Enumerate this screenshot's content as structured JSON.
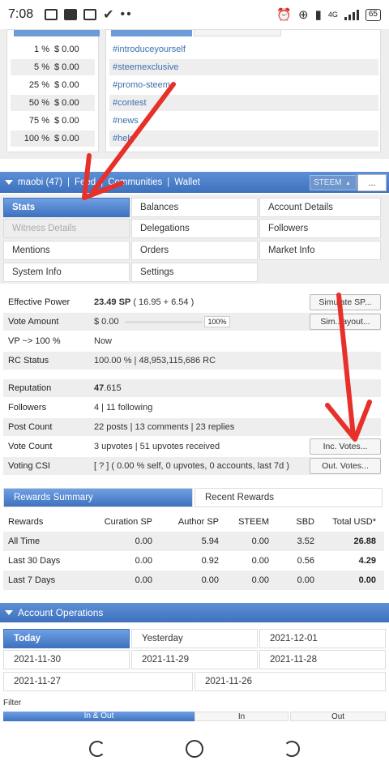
{
  "status_bar": {
    "time": "7:08",
    "network": "4G",
    "battery": "65"
  },
  "vote_values": [
    {
      "pct": "1 %",
      "value": "$ 0.00"
    },
    {
      "pct": "5 %",
      "value": "$ 0.00"
    },
    {
      "pct": "25 %",
      "value": "$ 0.00"
    },
    {
      "pct": "50 %",
      "value": "$ 0.00"
    },
    {
      "pct": "75 %",
      "value": "$ 0.00"
    },
    {
      "pct": "100 %",
      "value": "$ 0.00"
    }
  ],
  "tags": [
    "#introduceyourself",
    "#steemexclusive",
    "#promo-steem",
    "#contest",
    "#news",
    "#help"
  ],
  "account_bar": {
    "user": "maobi (47)",
    "links": [
      "Feed",
      "Communities",
      "Wallet"
    ],
    "currency": "STEEM",
    "more": "..."
  },
  "tabs": [
    {
      "label": "Stats",
      "state": "active"
    },
    {
      "label": "Balances",
      "state": "normal"
    },
    {
      "label": "Account Details",
      "state": "normal"
    },
    {
      "label": "Witness Details",
      "state": "disabled"
    },
    {
      "label": "Delegations",
      "state": "normal"
    },
    {
      "label": "Followers",
      "state": "normal"
    },
    {
      "label": "Mentions",
      "state": "normal"
    },
    {
      "label": "Orders",
      "state": "normal"
    },
    {
      "label": "Market Info",
      "state": "normal"
    },
    {
      "label": "System Info",
      "state": "normal"
    },
    {
      "label": "Settings",
      "state": "normal"
    }
  ],
  "stats": {
    "effective_power_label": "Effective Power",
    "effective_power_value": "23.49 SP",
    "effective_power_detail": " ( 16.95 + 6.54 )",
    "simulate_sp_button": "Simulate SP...",
    "vote_amount_label": "Vote Amount",
    "vote_amount_value": "$ 0.00",
    "vote_amount_pct": "100%",
    "simulate_layout_button": "Sim...ayout...",
    "vp_label": "VP ~> 100 %",
    "vp_value": "Now",
    "rc_label": "RC Status",
    "rc_value": "100.00 %  |  48,953,115,686 RC",
    "reputation_label": "Reputation",
    "reputation_int": "47",
    "reputation_dec": ".615",
    "followers_label": "Followers",
    "followers_value": "4  |  11 following",
    "post_count_label": "Post Count",
    "post_count_value": "22 posts  |  13 comments  |  23 replies",
    "vote_count_label": "Vote Count",
    "vote_count_value": "3 upvotes  |  51 upvotes received",
    "inc_votes_button": "Inc. Votes...",
    "voting_csi_label": "Voting CSI",
    "voting_csi_value": "[ ? ] ( 0.00 % self, 0 upvotes, 0 accounts, last 7d )",
    "out_votes_button": "Out. Votes..."
  },
  "rewards": {
    "tabs": [
      "Rewards Summary",
      "Recent Rewards"
    ],
    "columns": [
      "Rewards",
      "Curation SP",
      "Author SP",
      "STEEM",
      "SBD",
      "Total USD*"
    ],
    "rows": [
      {
        "period": "All Time",
        "curation": "0.00",
        "author": "5.94",
        "steem": "0.00",
        "sbd": "3.52",
        "total": "26.88"
      },
      {
        "period": "Last 30 Days",
        "curation": "0.00",
        "author": "0.92",
        "steem": "0.00",
        "sbd": "0.56",
        "total": "4.29"
      },
      {
        "period": "Last 7 Days",
        "curation": "0.00",
        "author": "0.00",
        "steem": "0.00",
        "sbd": "0.00",
        "total": "0.00"
      }
    ]
  },
  "operations": {
    "title": "Account Operations",
    "days": [
      "Today",
      "Yesterday",
      "2021-12-01",
      "2021-11-30",
      "2021-11-29",
      "2021-11-28",
      "2021-11-27",
      "2021-11-26"
    ],
    "filter_label": "Filter",
    "filter_tabs": [
      "In & Out",
      "In",
      "Out"
    ]
  },
  "colors": {
    "accent_blue": "#3f72be",
    "annotation_red": "#e8302a"
  }
}
